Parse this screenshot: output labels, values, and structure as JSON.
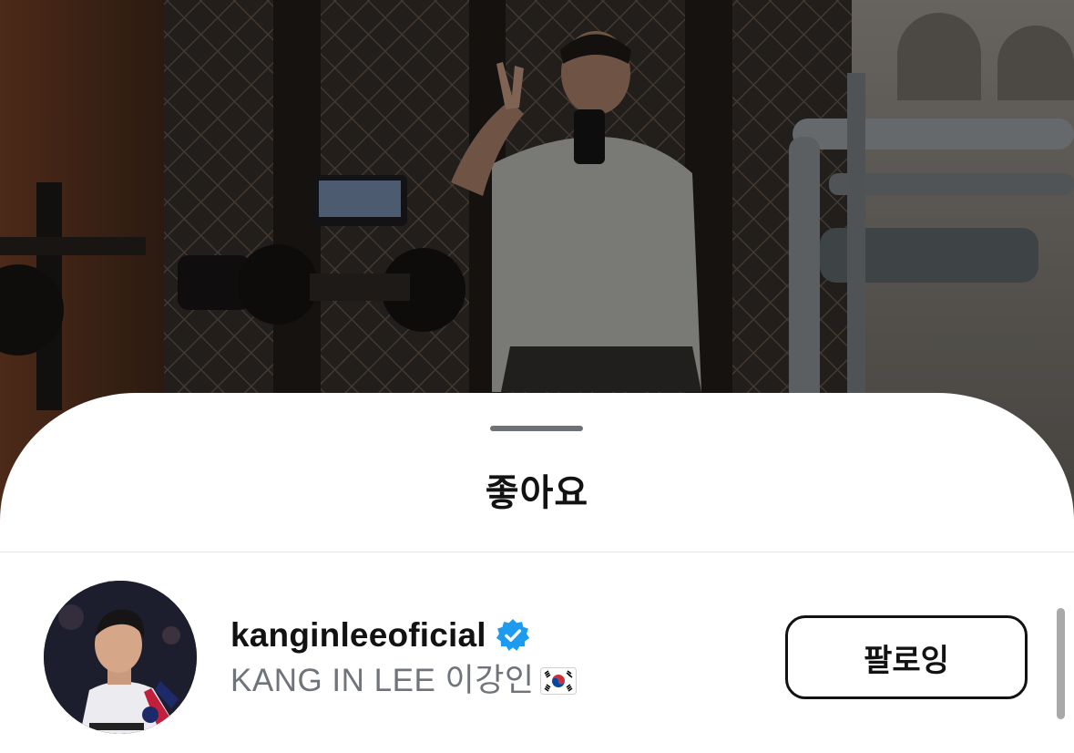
{
  "sheet": {
    "title": "좋아요"
  },
  "likes": [
    {
      "username": "kanginleeoficial",
      "verified": true,
      "full_name": "KANG IN LEE 이강인",
      "flag": "south-korea-flag",
      "button_label": "팔로잉"
    }
  ],
  "colors": {
    "verified_badge": "#1d9bf0",
    "text_primary": "#121212",
    "text_secondary": "#6f737a"
  }
}
